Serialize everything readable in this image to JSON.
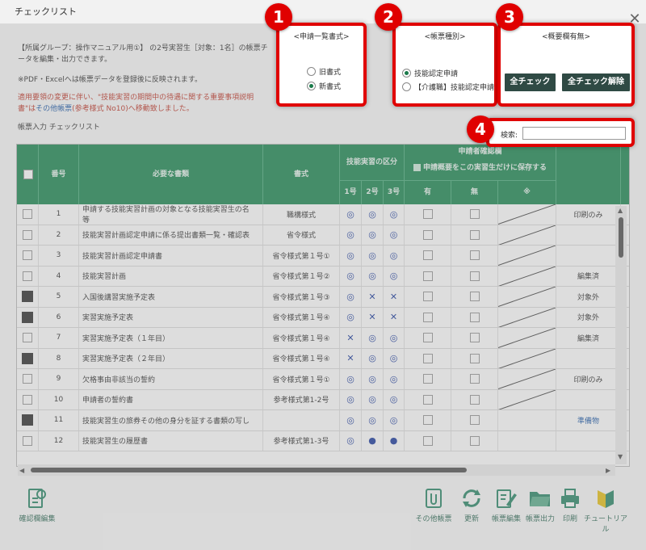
{
  "dialog": {
    "title": "チェックリスト",
    "close_glyph": "✕",
    "info_line1a": "【所属グループ：操作マニュアル用①】 の2号実習生［対象：1名］の帳票チ",
    "info_line1b": "ータを編集・出力できます。",
    "info_line2": "※PDF・Excelへは帳票データを登録後に反映されます。",
    "info_red1": "適用要領の変更に伴い、\"技能実習の期間中の待遇に関する重要事項説明",
    "info_red2a": "書\"は",
    "info_red2_link": "その他帳票",
    "info_red2b": "(参考様式 No10)へ移動致しました。",
    "list_title": "帳票入力 チェックリスト"
  },
  "panel1": {
    "badge": "1",
    "caption": "<申請一覧書式>",
    "options": [
      {
        "label": "旧書式",
        "checked": false
      },
      {
        "label": "新書式",
        "checked": true
      }
    ]
  },
  "panel2": {
    "badge": "2",
    "caption": "<帳票種別>",
    "options": [
      {
        "label": "技能認定申請",
        "checked": true
      },
      {
        "label": "【介護職】技能認定申請",
        "checked": false
      }
    ]
  },
  "panel3": {
    "badge": "3",
    "caption": "<概要欄有無>",
    "check_all": "全チェック",
    "uncheck_all": "全チェック解除"
  },
  "panel4": {
    "badge": "4",
    "search_label": "検索:",
    "search_value": ""
  },
  "table": {
    "headers": {
      "no": "番号",
      "doc": "必要な書類",
      "form": "書式",
      "division": "技能実習の区分",
      "go1": "1号",
      "go2": "2号",
      "go3": "3号",
      "confirm_title": "申請者確認欄",
      "confirm_sub": "申請概要をこの実習生だけに保存する",
      "yes": "有",
      "no_col": "無",
      "note": "※"
    },
    "rows": [
      {
        "no": "1",
        "doc": "申請する技能実習計画の対象となる技能実習生の名",
        "doc2": "等",
        "form": "職構様式",
        "g1": "◎",
        "g2": "◎",
        "g3": "◎",
        "remark": "印刷のみ",
        "dark": false,
        "diag": true
      },
      {
        "no": "2",
        "doc": "技能実習計画認定申請に係る提出書類一覧・確認表",
        "doc2": "",
        "form": "省令様式",
        "g1": "◎",
        "g2": "◎",
        "g3": "◎",
        "remark": "",
        "dark": false,
        "diag": true
      },
      {
        "no": "3",
        "doc": "技能実習計画認定申請書",
        "doc2": "",
        "form": "省令様式第１号①",
        "g1": "◎",
        "g2": "◎",
        "g3": "◎",
        "remark": "",
        "dark": false,
        "diag": true
      },
      {
        "no": "4",
        "doc": "技能実習計画",
        "doc2": "",
        "form": "省令様式第１号②",
        "g1": "◎",
        "g2": "◎",
        "g3": "◎",
        "remark": "編集済",
        "dark": false,
        "diag": true
      },
      {
        "no": "5",
        "doc": "入国後講習実施予定表",
        "doc2": "",
        "form": "省令様式第１号③",
        "g1": "◎",
        "g2": "✕",
        "g3": "✕",
        "remark": "対象外",
        "dark": true,
        "diag": true
      },
      {
        "no": "6",
        "doc": "実習実施予定表",
        "doc2": "",
        "form": "省令様式第１号④",
        "g1": "◎",
        "g2": "✕",
        "g3": "✕",
        "remark": "対象外",
        "dark": true,
        "diag": true
      },
      {
        "no": "7",
        "doc": "実習実施予定表（１年目）",
        "doc2": "",
        "form": "省令様式第１号④",
        "g1": "✕",
        "g2": "◎",
        "g3": "◎",
        "remark": "編集済",
        "dark": false,
        "diag": true
      },
      {
        "no": "8",
        "doc": "実習実施予定表（２年目）",
        "doc2": "",
        "form": "省令様式第１号④",
        "g1": "✕",
        "g2": "◎",
        "g3": "◎",
        "remark": "",
        "dark": true,
        "diag": true
      },
      {
        "no": "9",
        "doc": "欠格事由非該当の誓約",
        "doc2": "",
        "form": "省令様式第１号①",
        "g1": "◎",
        "g2": "◎",
        "g3": "◎",
        "remark": "印刷のみ",
        "dark": false,
        "diag": true
      },
      {
        "no": "10",
        "doc": "申請者の誓約書",
        "doc2": "",
        "form": "参考様式第1-2号",
        "g1": "◎",
        "g2": "◎",
        "g3": "◎",
        "remark": "",
        "dark": false,
        "diag": true
      },
      {
        "no": "11",
        "doc": "技能実習生の旅券その他の身分を証する書類の写し",
        "doc2": "",
        "form": "",
        "g1": "◎",
        "g2": "◎",
        "g3": "◎",
        "remark": "準備物",
        "dark": true,
        "diag": false
      },
      {
        "no": "12",
        "doc": "技能実習生の履歴書",
        "doc2": "",
        "form": "参考様式第1-3号",
        "g1": "◎",
        "g2": "●",
        "g3": "●",
        "remark": "",
        "dark": false,
        "diag": false
      }
    ]
  },
  "footer": {
    "left": "確認欄編集",
    "buttons": [
      "その他帳票",
      "更新",
      "帳票編集",
      "帳票出力",
      "印刷",
      "チュートリアル"
    ]
  },
  "colors": {
    "accent_red": "#e00000",
    "header_green": "#1f8a55",
    "button_dark": "#2f4a44"
  }
}
